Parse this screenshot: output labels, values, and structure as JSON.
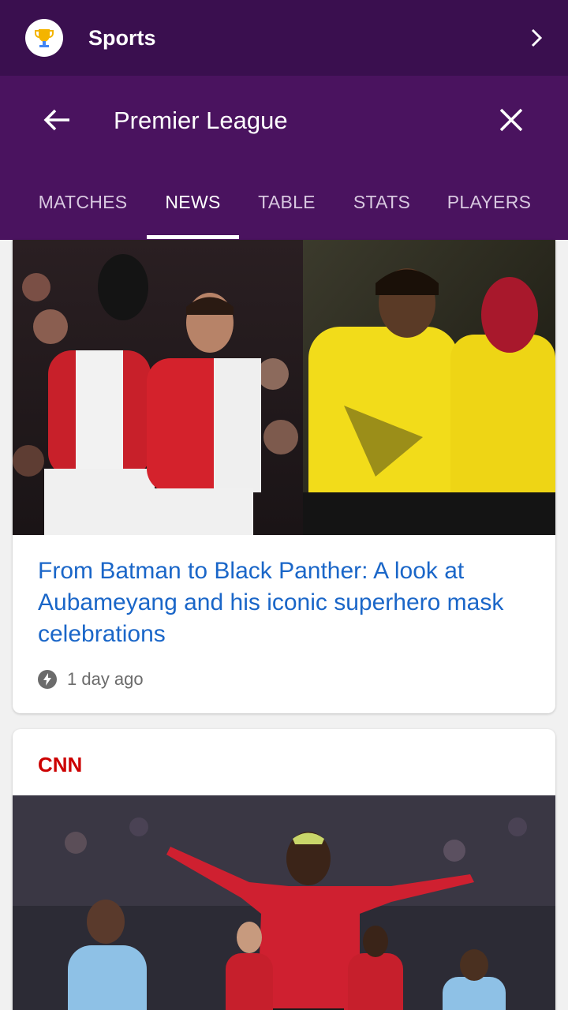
{
  "app": {
    "title": "Sports",
    "logo_icon": "trophy-icon"
  },
  "search": {
    "query": "Premier League"
  },
  "tabs": [
    {
      "label": "MATCHES"
    },
    {
      "label": "NEWS",
      "active": true
    },
    {
      "label": "TABLE"
    },
    {
      "label": "STATS"
    },
    {
      "label": "PLAYERS"
    }
  ],
  "articles": [
    {
      "headline": "From Batman to Black Panther: A look at Aubameyang and his iconic superhero mask celebrations",
      "time": "1 day ago",
      "meta_icon": "amp-bolt-icon"
    },
    {
      "source": "CNN"
    }
  ],
  "colors": {
    "header_bg": "#3a0f4f",
    "search_bg": "#4a135f",
    "headline": "#1a66c8",
    "cnn_red": "#cc0000"
  }
}
